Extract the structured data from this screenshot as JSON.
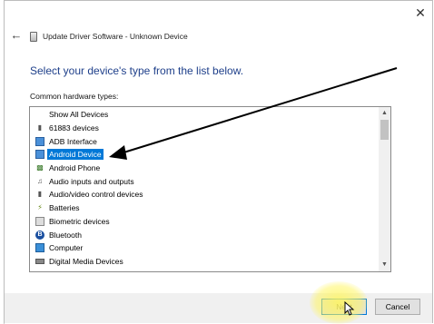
{
  "window": {
    "title": "Update Driver Software - Unknown Device",
    "close_glyph": "✕",
    "back_glyph": "←"
  },
  "heading": "Select your device's type from the list below.",
  "list_label": "Common hardware types:",
  "hardware_types": [
    {
      "label": "Show All Devices",
      "icon": "none"
    },
    {
      "label": "61883 devices",
      "icon": "plug-icon"
    },
    {
      "label": "ADB Interface",
      "icon": "adb-icon"
    },
    {
      "label": "Android Device",
      "icon": "android-device-icon",
      "selected": true
    },
    {
      "label": "Android Phone",
      "icon": "android-phone-icon"
    },
    {
      "label": "Audio inputs and outputs",
      "icon": "audio-icon"
    },
    {
      "label": "Audio/video control devices",
      "icon": "av-control-icon"
    },
    {
      "label": "Batteries",
      "icon": "battery-icon"
    },
    {
      "label": "Biometric devices",
      "icon": "biometric-icon"
    },
    {
      "label": "Bluetooth",
      "icon": "bluetooth-icon"
    },
    {
      "label": "Computer",
      "icon": "computer-icon"
    },
    {
      "label": "Digital Media Devices",
      "icon": "digital-media-icon"
    }
  ],
  "buttons": {
    "next": "Next",
    "cancel": "Cancel"
  },
  "colors": {
    "heading": "#1e3f8a",
    "selection": "#0078d7",
    "highlight": "#fff55a"
  }
}
